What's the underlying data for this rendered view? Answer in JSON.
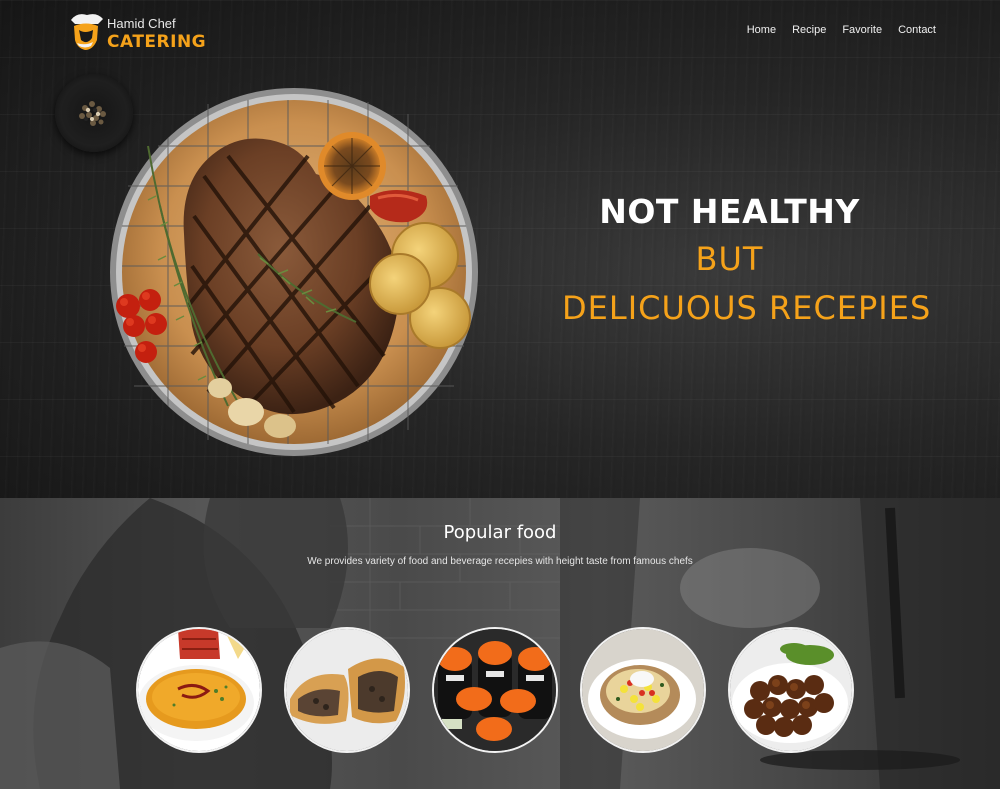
{
  "brand": {
    "line1": "Hamid Chef",
    "line2": "CATERING",
    "accent": "#f5a21a"
  },
  "nav": [
    {
      "label": "Home"
    },
    {
      "label": "Recipe"
    },
    {
      "label": "Favorite"
    },
    {
      "label": "Contact"
    }
  ],
  "hero": {
    "line1": "NOT HEALTHY",
    "line2": "BUT",
    "line3": "DELICUOUS RECEPIES"
  },
  "popular": {
    "title": "Popular food",
    "subtitle": "We provides variety of food and beverage recepies with height taste from famous chefs",
    "items": [
      {
        "icon": "soup-dish-icon"
      },
      {
        "icon": "meat-pie-icon"
      },
      {
        "icon": "sushi-icon"
      },
      {
        "icon": "loaded-potato-icon"
      },
      {
        "icon": "falafel-icon"
      }
    ]
  }
}
